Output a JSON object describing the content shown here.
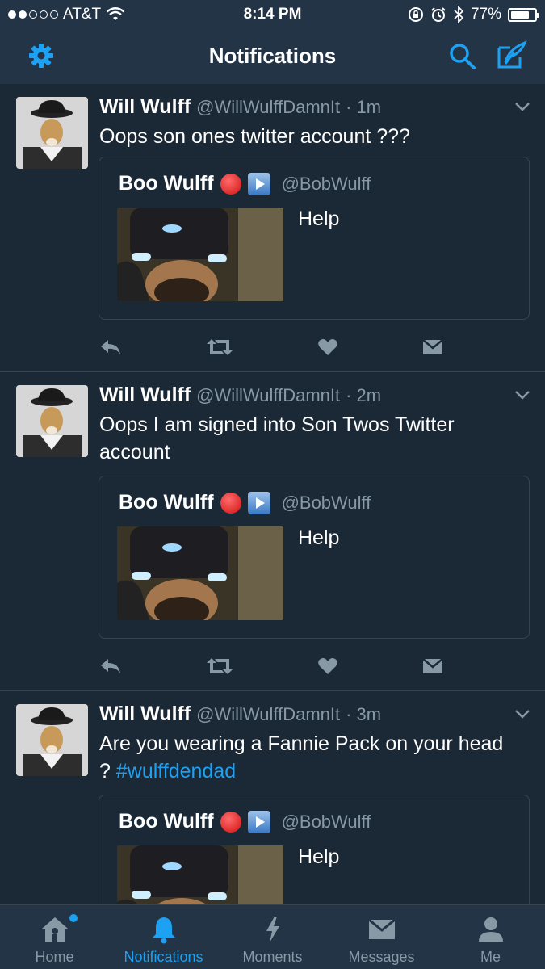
{
  "status_bar": {
    "carrier": "AT&T",
    "time": "8:14 PM",
    "battery": "77%",
    "battery_level": 0.77
  },
  "nav": {
    "title": "Notifications",
    "left_icon": "gear-icon",
    "right_icons": [
      "search-icon",
      "compose-icon"
    ]
  },
  "tweets": [
    {
      "name": "Will Wulff",
      "handle": "@WillWulffDamnIt",
      "time": "· 1m",
      "text": "Oops son ones twitter account ???",
      "quote": {
        "name": "Boo Wulff",
        "handle": "@BobWulff",
        "text": "Help"
      }
    },
    {
      "name": "Will Wulff",
      "handle": "@WillWulffDamnIt",
      "time": "· 2m",
      "text": "Oops I am signed into Son Twos Twitter account",
      "quote": {
        "name": "Boo Wulff",
        "handle": "@BobWulff",
        "text": "Help"
      }
    },
    {
      "name": "Will Wulff",
      "handle": "@WillWulffDamnIt",
      "time": "· 3m",
      "text": "Are you wearing a Fannie Pack on your head ?",
      "hashtag": "#wulffdendad",
      "quote": {
        "name": "Boo Wulff",
        "handle": "@BobWulff",
        "text": "Help"
      }
    }
  ],
  "tabs": [
    {
      "label": "Home",
      "icon": "home-icon"
    },
    {
      "label": "Notifications",
      "icon": "bell-icon"
    },
    {
      "label": "Moments",
      "icon": "lightning-icon"
    },
    {
      "label": "Messages",
      "icon": "envelope-icon"
    },
    {
      "label": "Me",
      "icon": "person-icon"
    }
  ],
  "colors": {
    "background": "#1b2836",
    "bar": "#243447",
    "accent": "#1da1f2",
    "muted": "#8899a6"
  }
}
